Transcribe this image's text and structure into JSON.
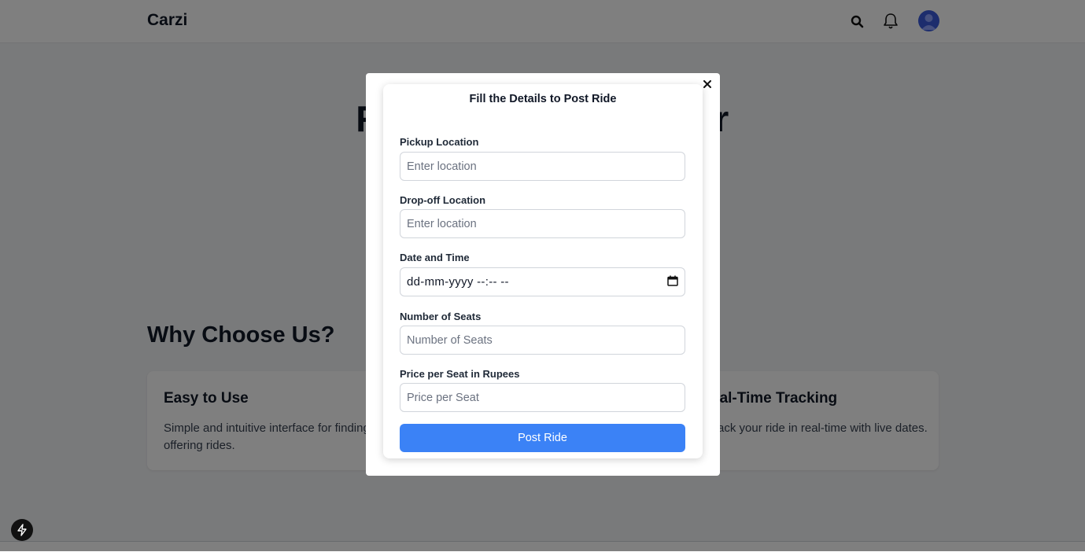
{
  "navbar": {
    "brand": "Carzi",
    "icons": [
      "search-icon",
      "bell-icon",
      "user-avatar"
    ]
  },
  "hero": {
    "title_left": "Rid",
    "title_right": "ther"
  },
  "features": {
    "section_title": "Why Choose Us?",
    "cards": [
      {
        "title": "Easy to Use",
        "text": "Simple and intuitive interface for finding and offering rides."
      },
      {
        "title": "eal-Time Tracking",
        "text": "ack your ride in real-time with live dates."
      }
    ]
  },
  "modal": {
    "title": "Fill the Details to Post Ride",
    "close_icon": "close-icon",
    "fields": {
      "pickup": {
        "label": "Pickup Location",
        "placeholder": "Enter location",
        "value": ""
      },
      "dropoff": {
        "label": "Drop-off Location",
        "placeholder": "Enter location",
        "value": ""
      },
      "datetime": {
        "label": "Date and Time",
        "display": "dd-mm-yyyy --:-- --",
        "icon": "calendar-icon"
      },
      "seats": {
        "label": "Number of Seats",
        "placeholder": "Number of Seats",
        "value": ""
      },
      "price": {
        "label": "Price per Seat in Rupees",
        "placeholder": "Price per Seat",
        "value": ""
      }
    },
    "submit_label": "Post Ride"
  },
  "colors": {
    "primary": "#3b82f6",
    "avatar": "#3b5bdb",
    "overlay": "rgba(0,0,0,0.5)"
  }
}
